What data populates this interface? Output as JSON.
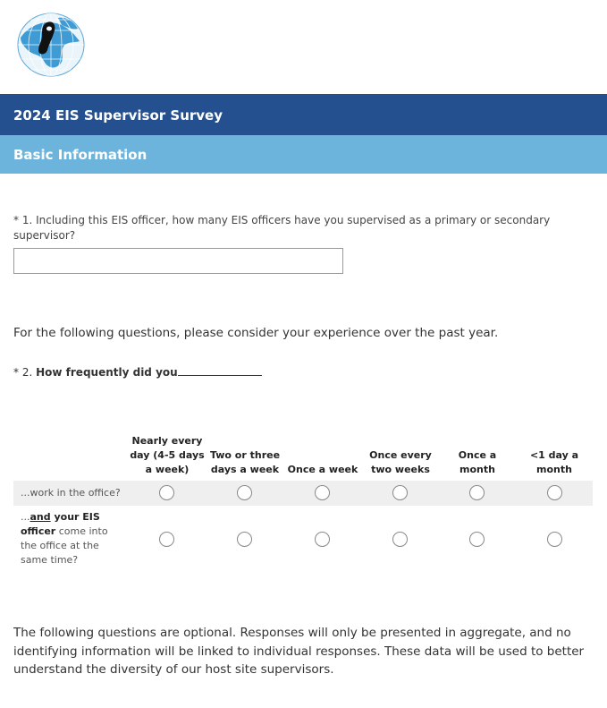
{
  "survey": {
    "title": "2024 EIS Supervisor Survey",
    "section": "Basic Information"
  },
  "question1": {
    "required_mark": "*",
    "number": "1.",
    "text": "Including this EIS officer, how many EIS officers have you supervised as a primary or secondary supervisor?",
    "value": "",
    "placeholder": ""
  },
  "intro_text": "For the following questions, please consider your experience over the past year.",
  "question2": {
    "required_mark": "*",
    "number": "2.",
    "text": "How frequently did you",
    "columns": [
      "Nearly every day (4-5 days a week)",
      "Two or three days a week",
      "Once a week",
      "Once every two weeks",
      "Once a month",
      "<1 day a month"
    ],
    "rows": [
      {
        "prefix": "...",
        "bold_underline": "",
        "bold": "",
        "rest": "work in the office?"
      },
      {
        "prefix": "...",
        "bold_underline": "and",
        "bold": " your EIS officer",
        "rest": " come into the office at the same time?"
      }
    ]
  },
  "optional_text": "The following questions are optional. Responses will only be presented in aggregate, and no identifying information will be linked to individual responses. These data will be used to better understand the diversity of our host site supervisors.",
  "colors": {
    "title_bar": "#24508f",
    "section_bar": "#6cb4dc",
    "row_shade": "#efefef"
  }
}
